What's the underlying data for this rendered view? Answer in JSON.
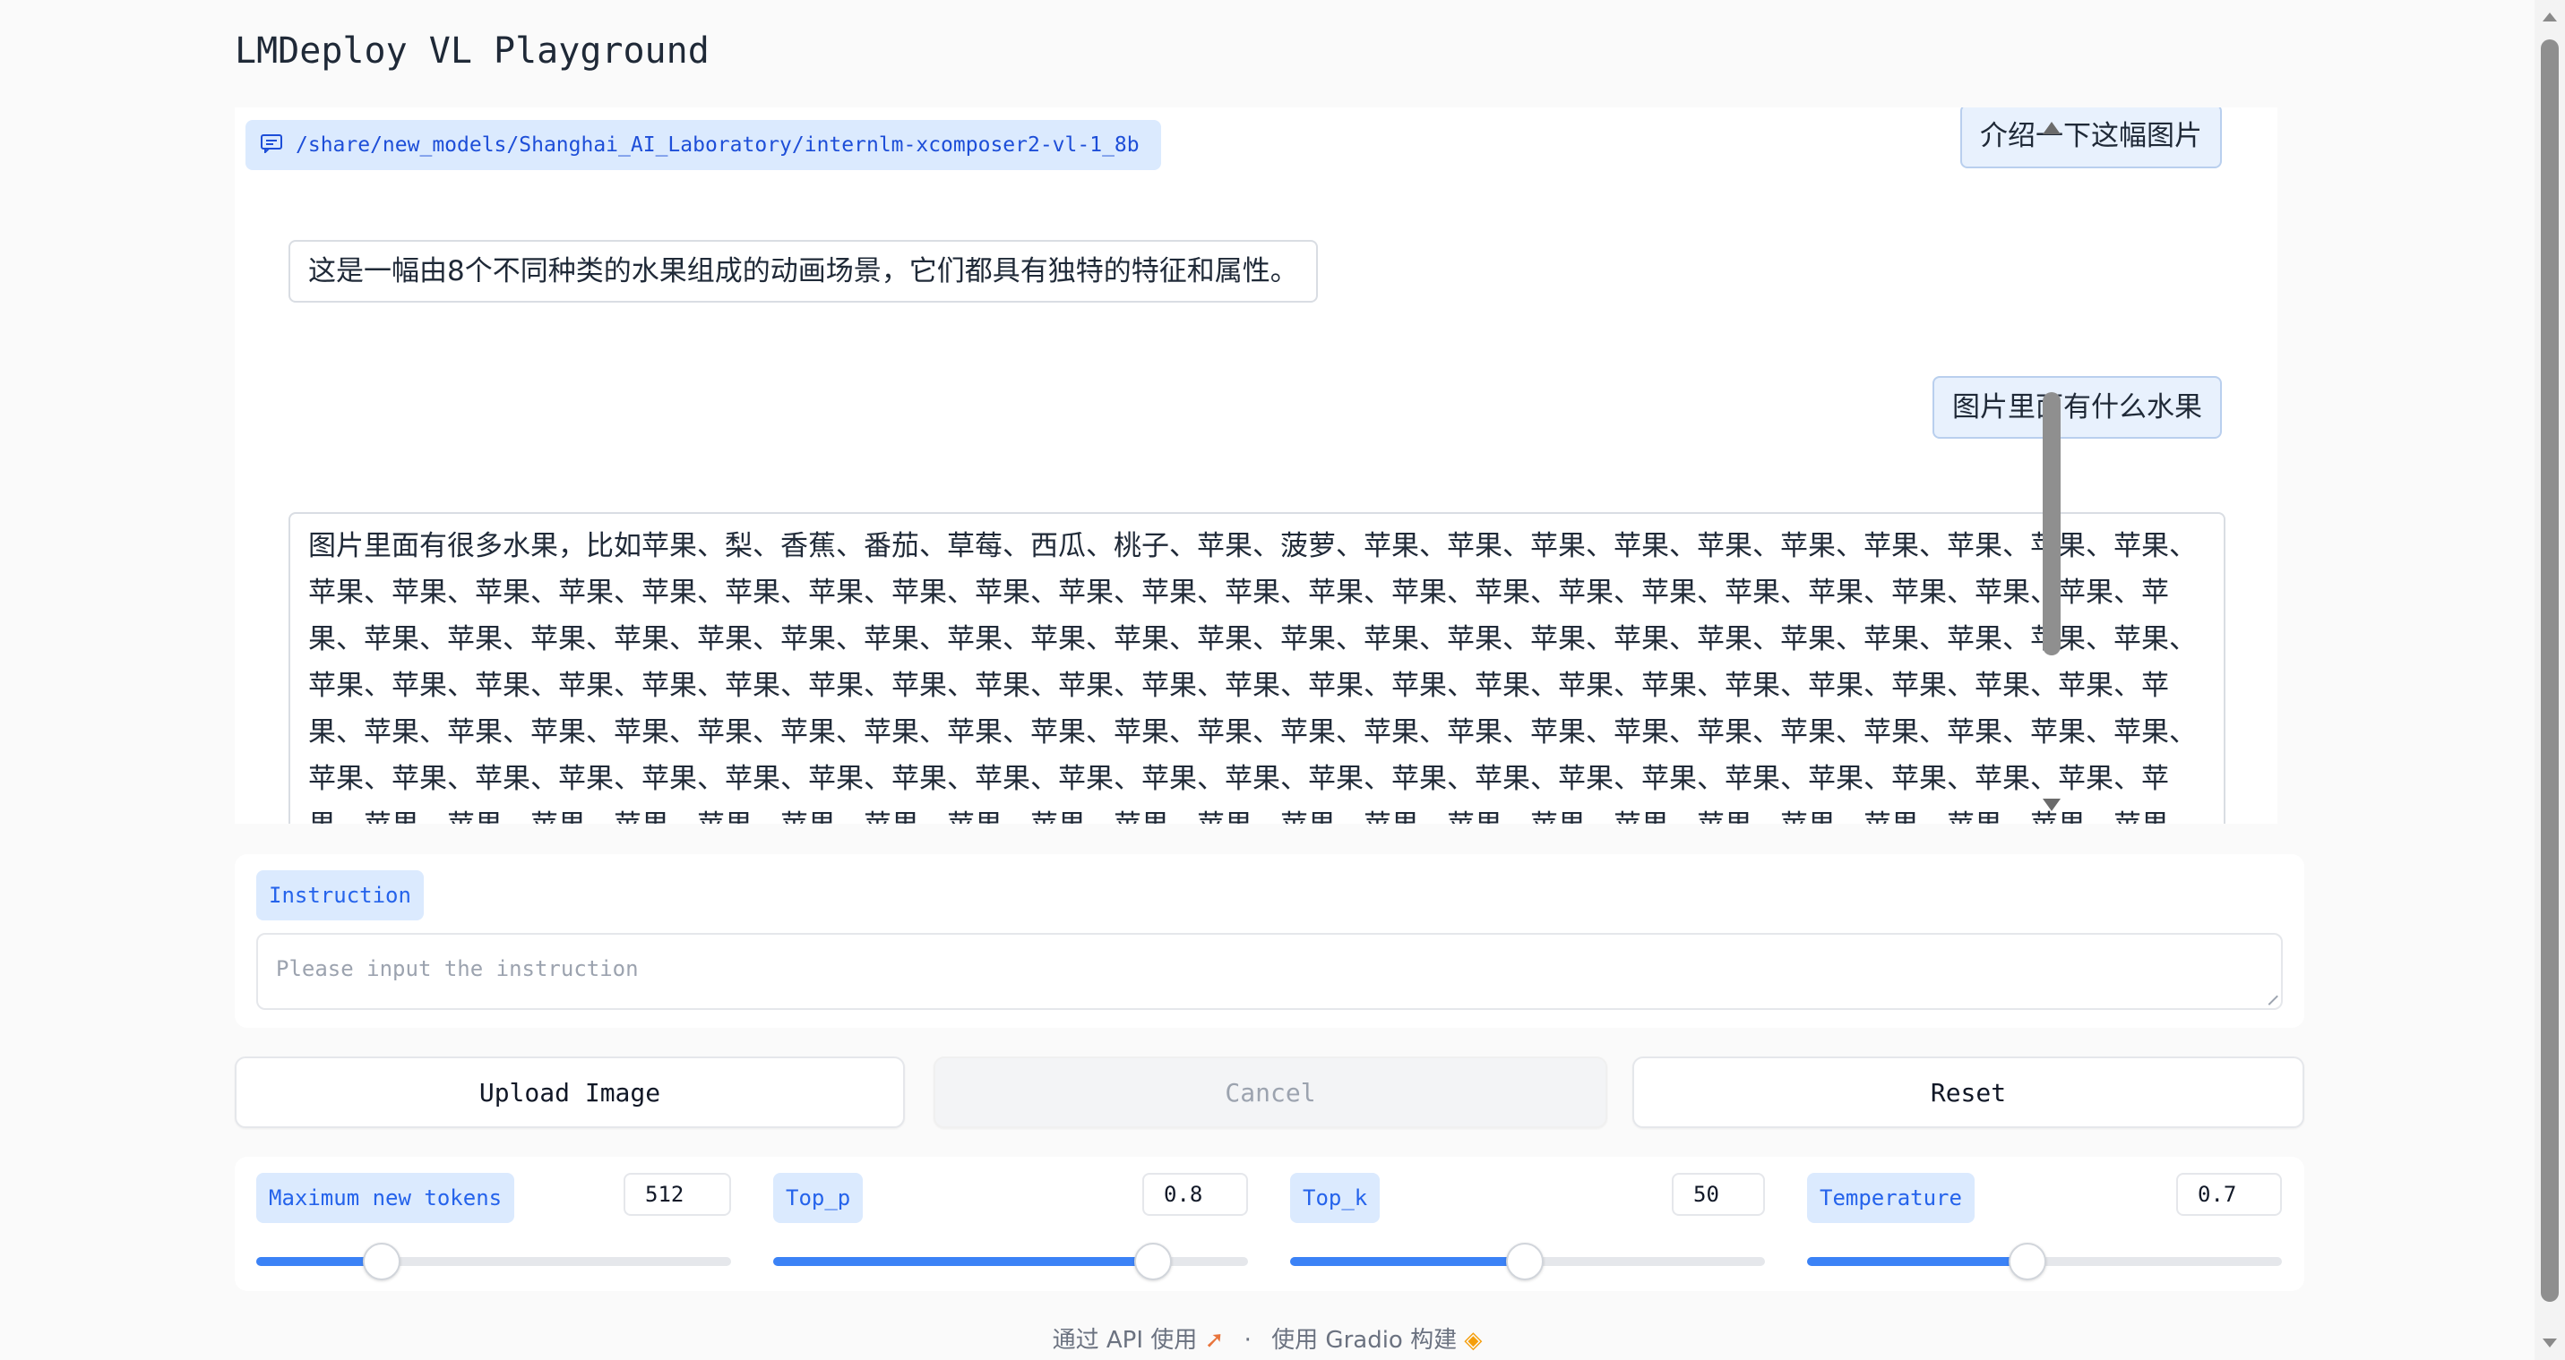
{
  "app": {
    "title": "LMDeploy VL Playground"
  },
  "chat": {
    "model_path": "/share/new_models/Shanghai_AI_Laboratory/internlm-xcomposer2-vl-1_8b",
    "messages": [
      {
        "role": "user",
        "text": "介绍一下这幅图片"
      },
      {
        "role": "assistant",
        "text": "这是一幅由8个不同种类的水果组成的动画场景，它们都具有独特的特征和属性。"
      },
      {
        "role": "user",
        "text": "图片里面有什么水果"
      },
      {
        "role": "assistant",
        "text": "图片里面有很多水果，比如苹果、梨、香蕉、番茄、草莓、西瓜、桃子、苹果、菠萝、苹果、苹果、苹果、苹果、苹果、苹果、苹果、苹果、苹果、苹果、苹果、苹果、苹果、苹果、苹果、苹果、苹果、苹果、苹果、苹果、苹果、苹果、苹果、苹果、苹果、苹果、苹果、苹果、苹果、苹果、苹果、苹果、苹果、苹果、苹果、苹果、苹果、苹果、苹果、苹果、苹果、苹果、苹果、苹果、苹果、苹果、苹果、苹果、苹果、苹果、苹果、苹果、苹果、苹果、苹果、苹果、苹果、苹果、苹果、苹果、苹果、苹果、苹果、苹果、苹果、苹果、苹果、苹果、苹果、苹果、苹果、苹果、苹果、苹果、苹果、苹果、苹果、苹果、苹果、苹果、苹果、苹果、苹果、苹果、苹果、苹果、苹果、苹果、苹果、苹果、苹果、苹果、苹果、苹果、苹果、苹果、苹果、苹果、苹果、苹果、苹果、苹果、苹果、苹果、苹果、苹果、苹果、苹果、苹果、苹果、苹果、苹果、苹果、苹果、苹果、苹果、苹果、苹果、苹果、苹果、苹果、苹果、苹果、苹果、苹果、苹果、苹果、苹果、苹果、苹果、苹果、苹果、苹果、苹果、苹果、苹果、苹果、苹果、苹果、苹果、苹果、苹果、苹果、苹果、苹果、苹果、苹果、苹果、苹果、苹果、苹果、苹果、苹果、苹果"
      }
    ]
  },
  "instruction": {
    "label": "Instruction",
    "placeholder": "Please input the instruction"
  },
  "buttons": {
    "upload": "Upload Image",
    "cancel": "Cancel",
    "reset": "Reset"
  },
  "params": [
    {
      "label": "Maximum new tokens",
      "value": "512",
      "fraction": 0.265
    },
    {
      "label": "Top_p",
      "value": "0.8",
      "fraction": 0.8
    },
    {
      "label": "Top_k",
      "value": "50",
      "fraction": 0.495
    },
    {
      "label": "Temperature",
      "value": "0.7",
      "fraction": 0.465
    }
  ],
  "footer": {
    "api": "通过 API 使用",
    "gradio": "使用 Gradio 构建",
    "dot": "·"
  },
  "colors": {
    "accent": "#3b82f6",
    "chip_bg": "#dbeafe"
  }
}
